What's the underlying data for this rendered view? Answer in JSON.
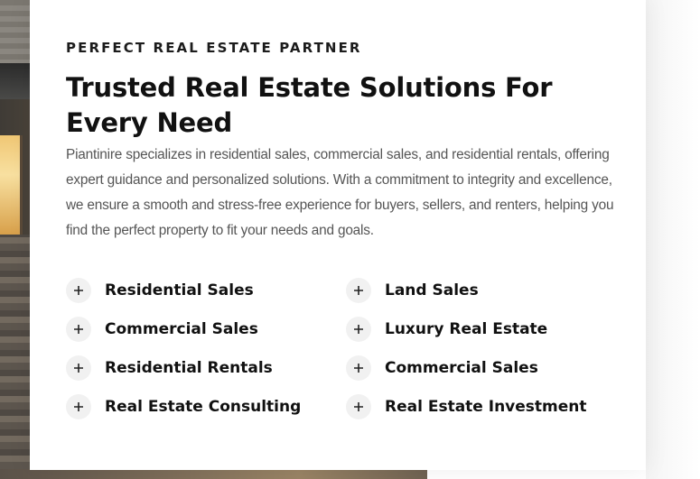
{
  "section": {
    "eyebrow": "PERFECT REAL ESTATE PARTNER",
    "title": "Trusted Real Estate Solutions For Every Need",
    "description": "Piantinire specializes in residential sales, commercial sales, and residential rentals, offering expert guidance and personalized solutions. With a commitment to integrity and excellence, we ensure a smooth and stress-free experience for buyers, sellers, and renters, helping you find the perfect property to fit your needs and goals."
  },
  "features": {
    "left": [
      {
        "label": "Residential Sales",
        "icon": "plus-icon"
      },
      {
        "label": "Commercial Sales",
        "icon": "plus-icon"
      },
      {
        "label": "Residential Rentals",
        "icon": "plus-icon"
      },
      {
        "label": "Real Estate Consulting",
        "icon": "plus-icon"
      }
    ],
    "right": [
      {
        "label": "Land Sales",
        "icon": "plus-icon"
      },
      {
        "label": "Luxury Real Estate",
        "icon": "plus-icon"
      },
      {
        "label": "Commercial Sales",
        "icon": "plus-icon"
      },
      {
        "label": "Real Estate Investment",
        "icon": "plus-icon"
      }
    ]
  },
  "colors": {
    "heading": "#111111",
    "body_text": "#555555",
    "icon_bg": "#f1f1f1"
  }
}
